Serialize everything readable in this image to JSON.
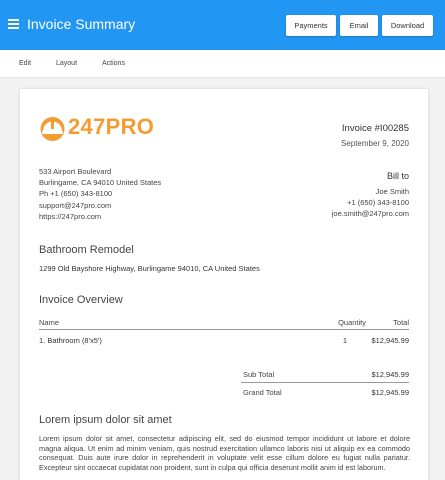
{
  "header": {
    "title": "Invoice Summary",
    "buttons": {
      "payments": "Payments",
      "email": "Email",
      "download": "Download"
    }
  },
  "menu": {
    "edit": "Edit",
    "layout": "Layout",
    "actions": "Actions"
  },
  "colors": {
    "header": "#2196f3",
    "brand": "#f39c33"
  },
  "invoice": {
    "logo_text": "247PRO",
    "number": "Invoice #I00285",
    "date": "September 9, 2020",
    "company_address": [
      "533 Airport Boulevard",
      "Burlingame, CA 94010 United States",
      "Ph +1 (650) 343-8100",
      "support@247pro.com",
      "https://247pro.com"
    ],
    "bill_to_heading": "Bill to",
    "bill_to": [
      "Joe Smith",
      "+1 (650) 343-8100",
      "joe.smith@247pro.com"
    ],
    "project_title": "Bathroom Remodel",
    "project_address": "1299 Old Bayshore Highway, Burlingame 94010, CA United States",
    "overview_title": "Invoice Overview",
    "table": {
      "headers": {
        "name": "Name",
        "quantity": "Quantity",
        "total": "Total"
      },
      "rows": [
        {
          "name": "1.  Bathroom (8'x5')",
          "quantity": "1",
          "total": "$12,945.99"
        }
      ]
    },
    "sub_total_label": "Sub Total",
    "sub_total": "$12,945.99",
    "grand_total_label": "Grand Total",
    "grand_total": "$12,945.99",
    "notes_title": "Lorem ipsum dolor sit amet",
    "notes_body": "Lorem ipsum dolor sit amet, consectetur adipiscing elit, sed do eiusmod tempor incididunt ut labore et dolore magna aliqua. Ut enim ad minim veniam, quis nostrud exercitation ullamco laboris nisi ut aliquip ex ea commodo consequat. Duis aute irure dolor in reprehenderit in voluptate velit esse cillum dolore eu fugiat nulla pariatur. Excepteur sint occaecat cupidatat non proident, sunt in culpa qui officia deserunt mollit anim id est laborum."
  }
}
